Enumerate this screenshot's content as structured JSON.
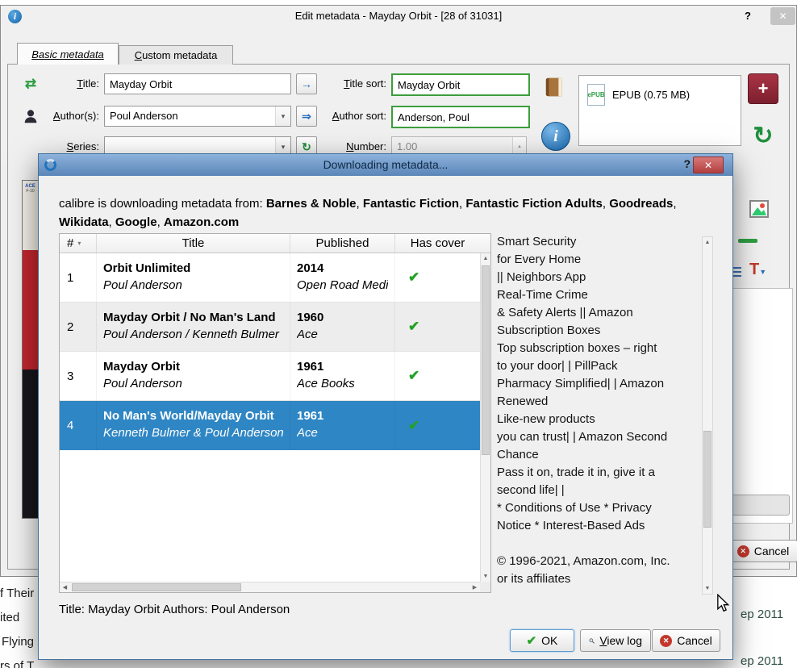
{
  "icons": {
    "close": "✕",
    "dropdown": "▾",
    "sort": "▾",
    "check": "✔",
    "up_arrow": "▲",
    "down_arrow": "▼",
    "left_arrow": "◀",
    "right_arrow": "▶",
    "swap": "⇄",
    "apply_arrow": "→",
    "double_arrow": "⇒",
    "recycle": "↻",
    "plus": "+",
    "info": "i",
    "letter_T": "T",
    "epub": "ePUB"
  },
  "background": {
    "list_fragments": [
      "f Their",
      "ited",
      "Flying",
      "rs of T"
    ],
    "date_fragment_1": "ep 2011",
    "date_fragment_2": "ep 2011",
    "cover_logo": "ACE",
    "cover_code": "F-10"
  },
  "edit_dialog": {
    "title": "Edit metadata - Mayday Orbit - [28 of 31031]",
    "help": "?",
    "tab_basic": "Basic metadata",
    "tab_custom": "Custom metadata",
    "form": {
      "title_label": "Title:",
      "title_value": "Mayday Orbit",
      "title_sort_label": "Title sort:",
      "title_sort_value": "Mayday Orbit",
      "authors_label": "Author(s):",
      "authors_value": "Poul Anderson",
      "author_sort_label": "Author sort:",
      "author_sort_value": "Anderson, Poul",
      "series_label": "Series:",
      "series_value": "",
      "number_label": "Number:",
      "number_value": "1.00"
    },
    "formats_entry": "EPUB (0.75 MB)",
    "cancel_label": "Cancel"
  },
  "modal": {
    "title": "Downloading metadata...",
    "help": "?",
    "intro_prefix": "calibre is downloading metadata from: ",
    "separator": ", ",
    "sources": [
      "Barnes & Noble",
      "Fantastic Fiction",
      "Fantastic Fiction Adults",
      "Goodreads",
      "Wikidata",
      "Google",
      "Amazon.com"
    ],
    "table": {
      "header_num": "#",
      "header_title": "Title",
      "header_published": "Published",
      "header_cover": "Has cover",
      "rows": [
        {
          "num": "1",
          "title": "Orbit Unlimited",
          "authors": "Poul Anderson",
          "year": "2014",
          "publisher": "Open Road Media"
        },
        {
          "num": "2",
          "title": "Mayday Orbit / No Man's Land",
          "authors": "Poul Anderson / Kenneth Bulmer",
          "year": "1960",
          "publisher": "Ace"
        },
        {
          "num": "3",
          "title": "Mayday Orbit",
          "authors": "Poul Anderson",
          "year": "1961",
          "publisher": "Ace Books"
        },
        {
          "num": "4",
          "title": "No Man's World/Mayday Orbit",
          "authors": "Kenneth Bulmer & Poul Anderson",
          "year": "1961",
          "publisher": "Ace"
        }
      ]
    },
    "preview_lines": [
      "Smart Security",
      "for Every Home",
      "|| Neighbors App",
      "Real-Time Crime",
      "& Safety Alerts || Amazon",
      "Subscription Boxes",
      "Top subscription boxes – right",
      "to your door| | PillPack",
      "Pharmacy Simplified| | Amazon",
      "Renewed",
      "Like-new products",
      "you can trust| | Amazon Second",
      "Chance",
      "Pass it on, trade it in, give it a",
      "second life| |",
      "* Conditions of Use * Privacy",
      "Notice * Interest-Based Ads",
      "",
      "© 1996-2021, Amazon.com, Inc.",
      "or its affiliates"
    ],
    "status": "Title: Mayday Orbit Authors: Poul Anderson",
    "ok_label": "OK",
    "view_log_label": "View log",
    "cancel_label": "Cancel"
  }
}
